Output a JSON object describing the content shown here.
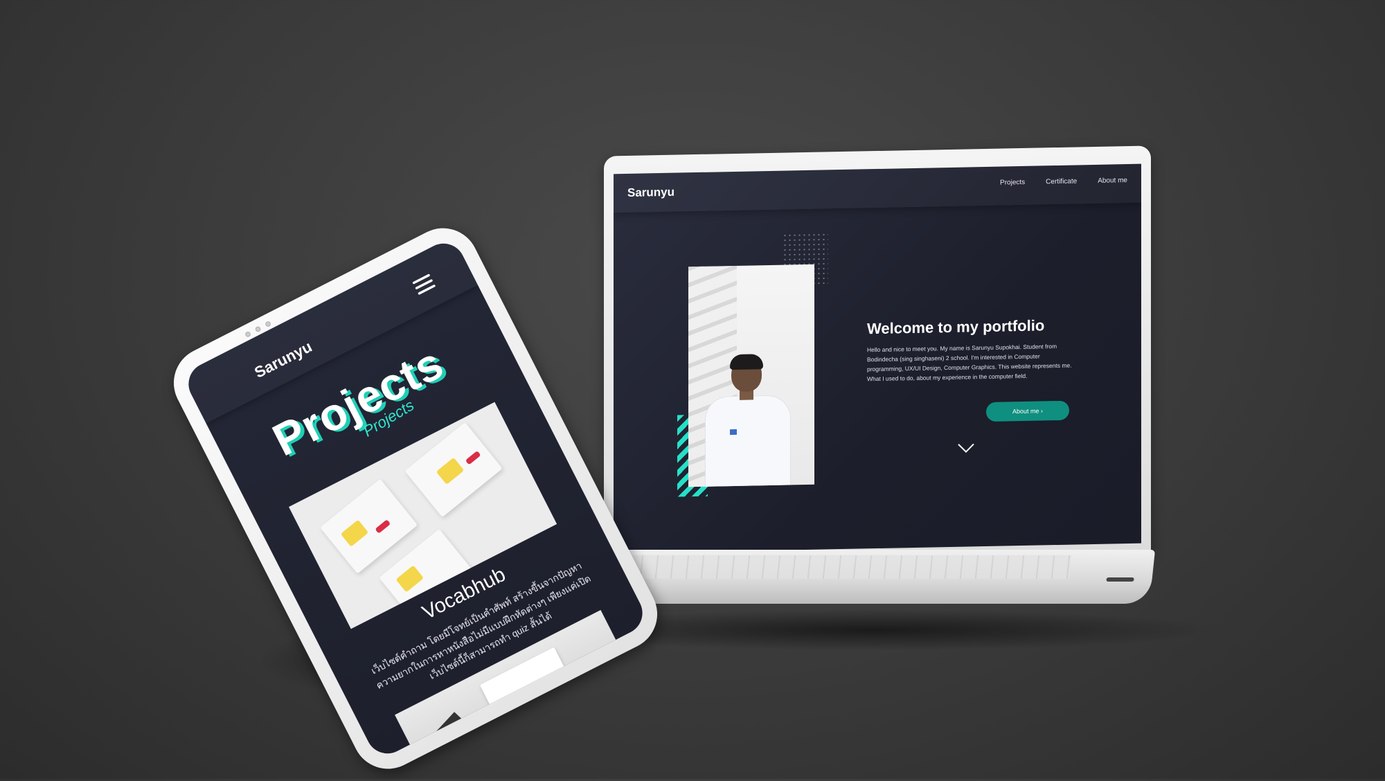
{
  "laptop": {
    "site": {
      "logo": "Sarunyu",
      "nav": [
        "Projects",
        "Certificate",
        "About me"
      ],
      "hero_title": "Welcome to my portfolio",
      "hero_description": "Hello and nice to meet you. My name is Sarunyu Supokhai. Student from Bodindecha (sing singhaseni) 2 school. I'm interested in Computer programming, UX/UI Design, Computer Graphics. This website represents me. What I used to do, about my experience in the computer field.",
      "cta_label": "About me ›",
      "scroll_icon": "chevron-down-icon"
    }
  },
  "tablet": {
    "site": {
      "logo": "Sarunyu",
      "menu_icon": "hamburger-menu-icon",
      "section_heading": "Projects",
      "section_script": "Projects",
      "project_title": "Vocabhub",
      "project_description": "เว็บไซต์คำถาม โดยมีโจทย์เป็นคำศัพท์ สร้างขึ้นจากปัญหาความยากในการหาหนังสือไม่มีแบบฝึกหัดต่างๆ เพียงแค่เปิดเว็บไซต์นี้ก็สามารถทำ quiz สั้นได้"
    }
  },
  "colors": {
    "background": "#3a3a3a",
    "screen": "#1d1f2c",
    "accent": "#1fcfb6",
    "button": "#0f8f7f"
  }
}
